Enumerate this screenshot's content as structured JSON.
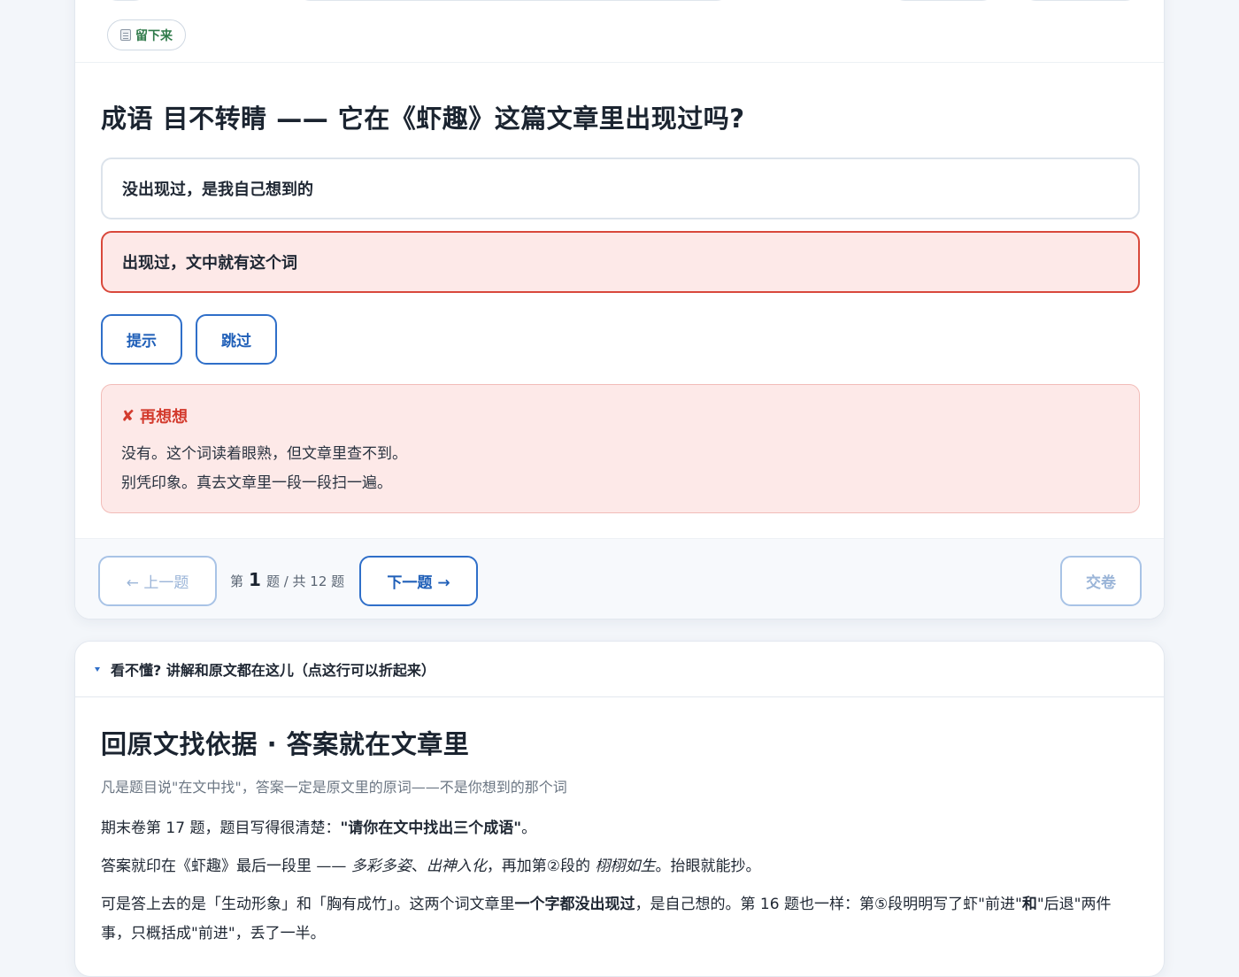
{
  "quiz": {
    "save_chip": "留下来",
    "question": "成语 目不转睛 —— 它在《虾趣》这篇文章里出现过吗?",
    "options": [
      {
        "label": "没出现过，是我自己想到的"
      },
      {
        "label": "出现过，文中就有这个词"
      }
    ],
    "hint_label": "提示",
    "skip_label": "跳过",
    "feedback": {
      "icon": "✘",
      "title": "再想想",
      "line1": "没有。这个词读着眼熟，但文章里查不到。",
      "line2": "别凭印象。真去文章里一段一段扫一遍。"
    },
    "footer": {
      "prev_label": "← 上一题",
      "progress_prefix": "第",
      "current": "1",
      "progress_mid": "题 / 共 12 题",
      "next_label": "下一题 →",
      "submit_label": "交卷"
    }
  },
  "explain": {
    "summary": "看不懂? 讲解和原文都在这儿（点这行可以折起来）",
    "title": "回原文找依据 · 答案就在文章里",
    "subtitle": "凡是题目说\"在文中找\"，答案一定是原文里的原词——不是你想到的那个词",
    "para1_pre": "期末卷第 17 题，题目写得很清楚：",
    "para1_bold": "\"请你在文中找出三个成语\"",
    "para1_post": "。",
    "para2_pre": "答案就印在《虾趣》最后一段里 —— ",
    "para2_it1": "多彩多姿",
    "para2_sep": "、",
    "para2_it2": "出神入化",
    "para2_mid": "，再加第②段的 ",
    "para2_it3": "栩栩如生",
    "para2_post": "。抬眼就能抄。",
    "para3_pre": "可是答上去的是「生动形象」和「胸有成竹」。这两个词文章里",
    "para3_bold1": "一个字都没出现过",
    "para3_mid": "，是自己想的。第 16 题也一样：第⑤段明明写了虾\"前进\"",
    "para3_bold2": "和",
    "para3_post": "\"后退\"两件事，只概括成\"前进\"，丢了一半。"
  },
  "colors": {
    "accent": "#2f6fc9",
    "error": "#d33b2e",
    "error_bg": "#fde9e8",
    "save_green": "#2f7a4a"
  },
  "icons": [
    "note-icon",
    "cross-icon",
    "disclosure-triangle-icon"
  ]
}
